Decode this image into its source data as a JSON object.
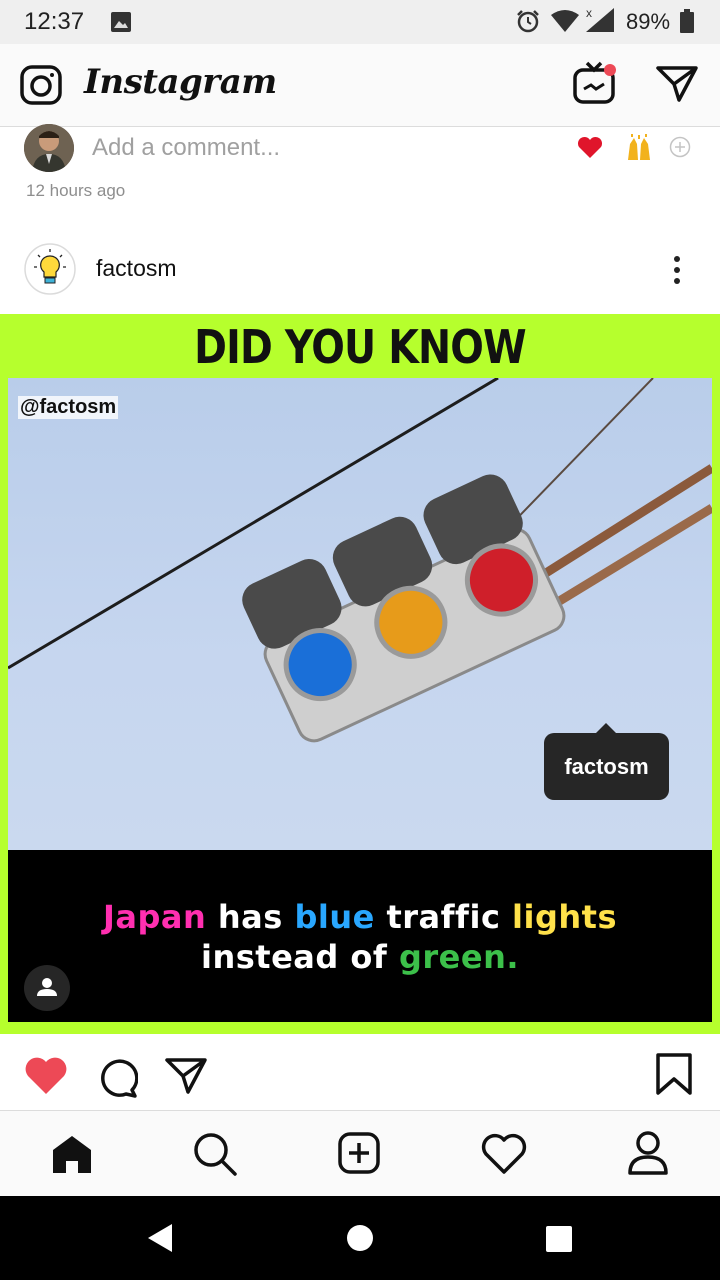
{
  "status_bar": {
    "time": "12:37",
    "battery": "89%"
  },
  "header": {
    "app_name": "Instagram"
  },
  "comment": {
    "placeholder": "Add a comment...",
    "time_ago": "12 hours ago"
  },
  "post": {
    "username": "factosm",
    "image": {
      "headline": "DID YOU KNOW",
      "watermark": "@factosm",
      "tag": "factosm",
      "caption_line1": [
        {
          "text": "Japan",
          "color": "#ff2fb0"
        },
        {
          "text": " has ",
          "color": "#ffffff"
        },
        {
          "text": "blue",
          "color": "#29a7ff"
        },
        {
          "text": " traffic ",
          "color": "#ffffff"
        },
        {
          "text": "lights",
          "color": "#ffe14a"
        }
      ],
      "caption_line2": [
        {
          "text": "instead of ",
          "color": "#ffffff"
        },
        {
          "text": "green.",
          "color": "#3cc04a"
        }
      ]
    },
    "liked": true
  },
  "bottom_nav": {
    "items": [
      "home-icon",
      "search-icon",
      "add-post-icon",
      "activity-icon",
      "profile-icon"
    ]
  },
  "system_nav": {
    "items": [
      "back-icon",
      "home-icon",
      "recents-icon"
    ]
  },
  "colors": {
    "like_red": "#ed4956",
    "post_bg": "#b6ff2d"
  }
}
